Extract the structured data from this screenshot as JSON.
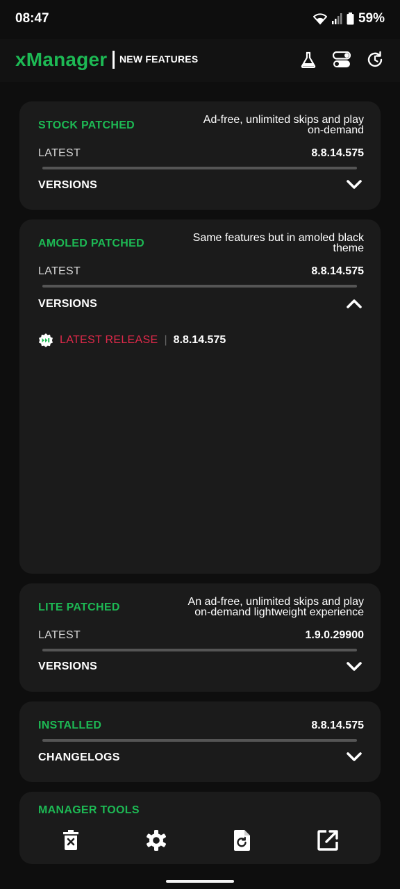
{
  "status_bar": {
    "time": "08:47",
    "battery": "59%"
  },
  "header": {
    "app_name": "xManager",
    "subtitle": "NEW FEATURES"
  },
  "cards": {
    "stock": {
      "title": "STOCK PATCHED",
      "desc_line1": "Ad-free, unlimited skips and play",
      "desc_line2": "on-demand",
      "latest_label": "LATEST",
      "latest_value": "8.8.14.575",
      "versions_label": "VERSIONS"
    },
    "amoled": {
      "title": "AMOLED PATCHED",
      "desc_line1": "Same features but in amoled black",
      "desc_line2": "theme",
      "latest_label": "LATEST",
      "latest_value": "8.8.14.575",
      "versions_label": "VERSIONS",
      "release_label": "LATEST RELEASE",
      "release_sep": "|",
      "release_version": "8.8.14.575"
    },
    "lite": {
      "title": "LITE PATCHED",
      "desc_line1": "An ad-free, unlimited skips and play",
      "desc_line2": "on-demand lightweight experience",
      "latest_label": "LATEST",
      "latest_value": "1.9.0.29900",
      "versions_label": "VERSIONS"
    },
    "installed": {
      "title": "INSTALLED",
      "value": "8.8.14.575",
      "changelogs_label": "CHANGELOGS"
    },
    "tools": {
      "title": "MANAGER TOOLS"
    }
  },
  "colors": {
    "accent_green": "#1db954",
    "release_red": "#e0294a",
    "card_bg": "#1b1b1b",
    "page_bg": "#0e0e0e"
  },
  "icons": [
    "wifi-icon",
    "signal-icon",
    "battery-icon",
    "flask-icon",
    "toggle-icon",
    "update-icon",
    "chevron-down-icon",
    "chevron-up-icon",
    "release-badge-icon",
    "delete-icon",
    "settings-icon",
    "restore-file-icon",
    "open-external-icon"
  ]
}
